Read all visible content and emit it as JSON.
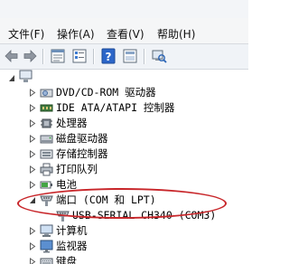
{
  "menu": {
    "file": "文件(F)",
    "action": "操作(A)",
    "view": "查看(V)",
    "help": "帮助(H)"
  },
  "toolbar_icons": [
    "back-arrow",
    "forward-arrow",
    "properties",
    "device-list",
    "help",
    "scan-hardware",
    "update-driver"
  ],
  "tree": {
    "items": [
      {
        "label": "DVD/CD-ROM 驱动器",
        "icon": "dvd-drive",
        "expanded": false
      },
      {
        "label": "IDE ATA/ATAPI 控制器",
        "icon": "ide-controller",
        "expanded": false
      },
      {
        "label": "处理器",
        "icon": "processor",
        "expanded": false
      },
      {
        "label": "磁盘驱动器",
        "icon": "disk-drive",
        "expanded": false
      },
      {
        "label": "存储控制器",
        "icon": "storage-controller",
        "expanded": false
      },
      {
        "label": "打印队列",
        "icon": "printer",
        "expanded": false
      },
      {
        "label": "电池",
        "icon": "battery",
        "expanded": false
      },
      {
        "label": "端口 (COM 和 LPT)",
        "icon": "port",
        "expanded": true
      },
      {
        "label": "USB-SERIAL CH340 (COM3)",
        "icon": "port",
        "child": true
      },
      {
        "label": "计算机",
        "icon": "computer",
        "expanded": false
      },
      {
        "label": "监视器",
        "icon": "monitor",
        "expanded": false
      },
      {
        "label": "键盘",
        "icon": "keyboard",
        "expanded": false
      }
    ]
  },
  "highlight_color": "#c8262a"
}
